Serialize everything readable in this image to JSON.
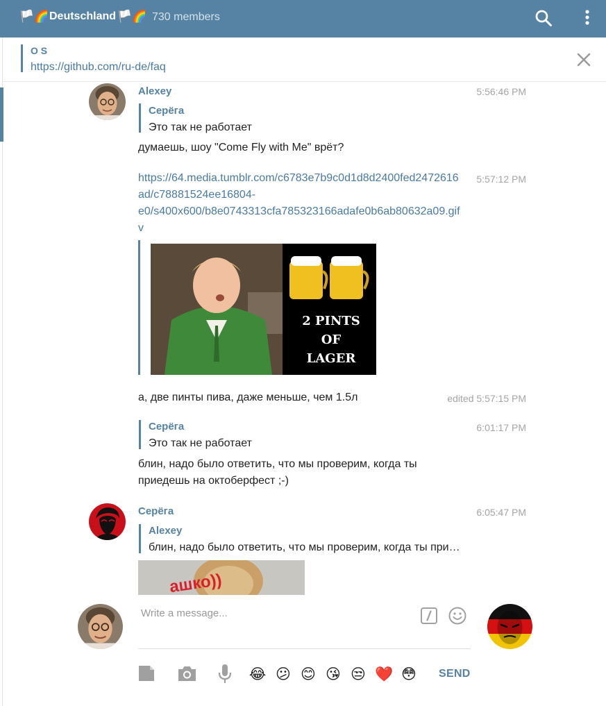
{
  "header": {
    "flag_left": "🏳️🌈",
    "title": "Deutschland",
    "flag_right": "🏳️🌈",
    "members": "730 members",
    "accent": "#5682a3"
  },
  "pinned": {
    "name": "O S",
    "link": "https://github.com/ru-de/faq"
  },
  "messages": [
    {
      "author": "Alexey",
      "time": "5:56:46 PM",
      "reply_name": "Серёга",
      "reply_text": "Это так не работает",
      "text": "думаешь, шоу \"Come Fly with Me\" врёт?"
    },
    {
      "time": "5:57:12 PM",
      "link_lines": [
        "https://64.media.tumblr.com/c6783e7b9c0d1d8d2400fed2472616",
        "ad/c78881524ee16804-",
        "e0/s400x600/b8e0743313cfa785323166adafe0b6ab80632a09.gif",
        "v"
      ],
      "image_caption": [
        "2 PINTS",
        "OF",
        "LAGER"
      ]
    },
    {
      "time": "edited 5:57:15 PM",
      "text": "а, две пинты пива, даже меньше, чем 1.5л"
    },
    {
      "time": "6:01:17 PM",
      "reply_name": "Серёга",
      "reply_text": "Это так не работает",
      "text_lines": [
        "блин, надо было ответить, что мы проверим, когда ты",
        "приедешь на октоберфест ;-)"
      ]
    },
    {
      "author": "Серёга",
      "time": "6:05:47 PM",
      "reply_name": "Alexey",
      "reply_text": "блин, надо было ответить, что мы проверим, когда ты при…",
      "image_text": "ашко))"
    }
  ],
  "composer": {
    "placeholder": "Write a message...",
    "send_label": "SEND",
    "emojis": [
      "😂",
      "😕",
      "😊",
      "😘",
      "😒",
      "❤️",
      "😳"
    ]
  }
}
